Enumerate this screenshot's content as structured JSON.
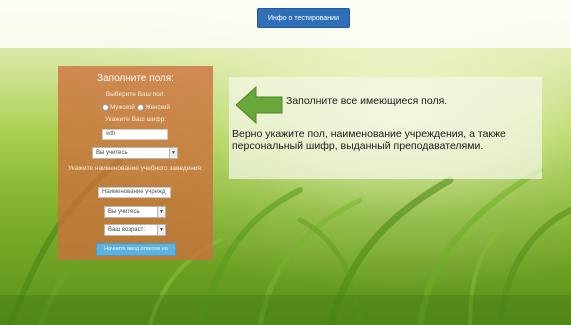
{
  "header": {
    "info_button_label": "Инфо о тестировании"
  },
  "form": {
    "title": "Заполните поля:",
    "gender_label": "Выберите Ваш пол:",
    "gender_options": [
      "Мужской",
      "Женский"
    ],
    "cipher_label": "Укажите Ваш шифр:",
    "cipher_value": "wth",
    "study_select": "Вы учитесь",
    "institution_label": "Укажите наименование учебного заведения:",
    "institution_placeholder": "Наименование учрежд",
    "course_select": "Вы учитесь",
    "age_select": "Ваш возраст:",
    "submit_label": "Начните ввод ответов на"
  },
  "hint": {
    "title": "Заполните все имеющиеся поля.",
    "text": "Верно укажите пол, наименование учреждения, а также персональный шифр, выданный преподавателями."
  },
  "colors": {
    "accent": "#2f6fb8",
    "form_panel": "#cd6e3c",
    "arrow": "#6aa63a",
    "submit": "#5fb0dc"
  },
  "icons": {
    "arrow": "arrow-left-icon"
  }
}
